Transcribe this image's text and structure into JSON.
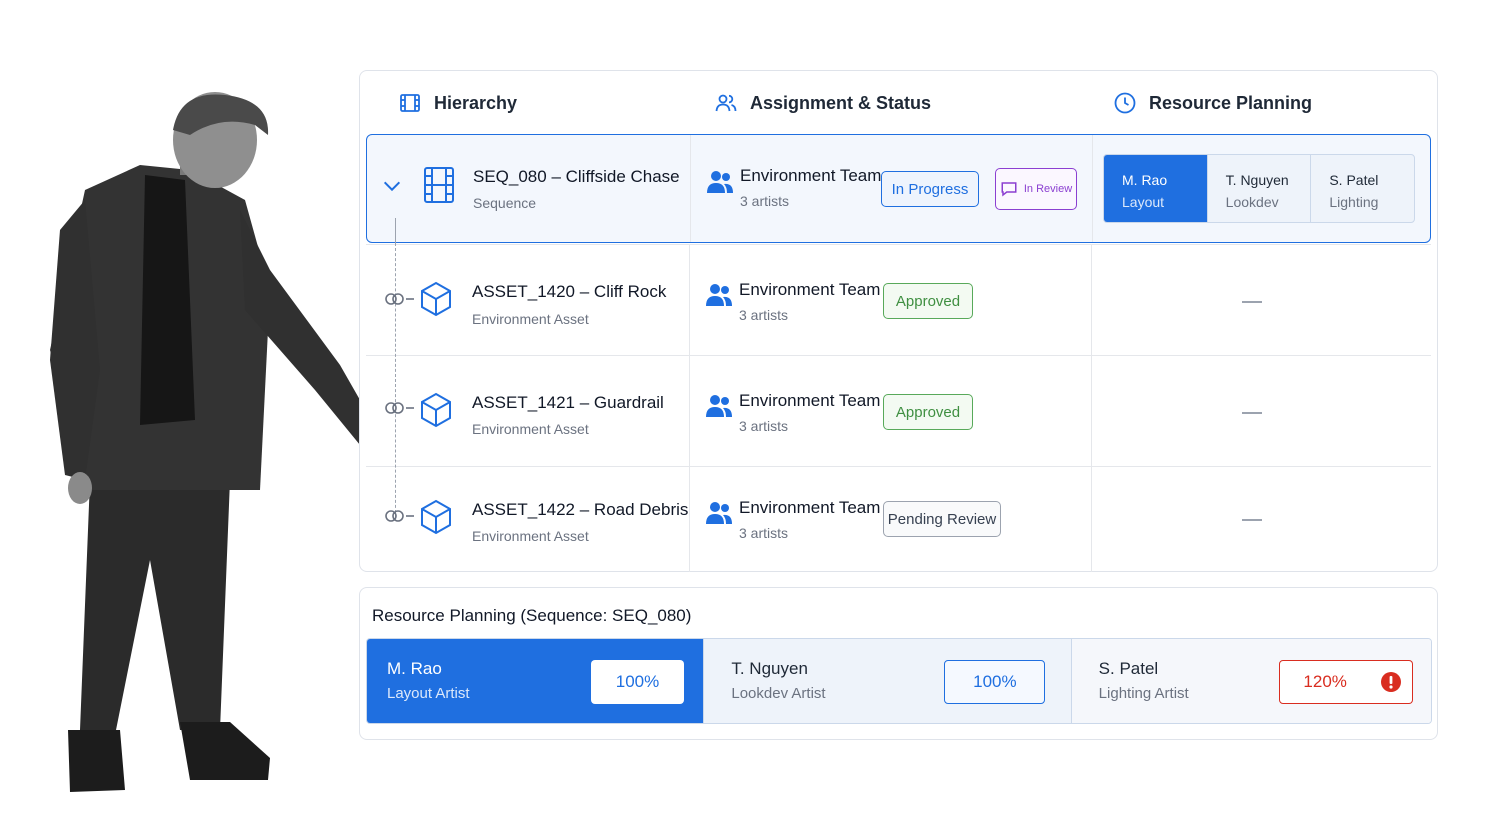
{
  "headers": {
    "hierarchy": "Hierarchy",
    "assignment": "Assignment & Status",
    "resource": "Resource Planning"
  },
  "rows": [
    {
      "title": "SEQ_080 – Cliffside Chase",
      "subtitle": "Sequence",
      "team": "Environment Team",
      "count": "3 artists",
      "status": "In Progress",
      "review": "In Review",
      "planning": [
        {
          "name": "M. Rao",
          "role": "Layout"
        },
        {
          "name": "T. Nguyen",
          "role": "Lookdev"
        },
        {
          "name": "S. Patel",
          "role": "Lighting"
        }
      ]
    },
    {
      "title": "ASSET_1420 – Cliff Rock",
      "subtitle": "Environment Asset",
      "team": "Environment Team",
      "count": "3 artists",
      "status": "Approved"
    },
    {
      "title": "ASSET_1421 – Guardrail",
      "subtitle": "Environment Asset",
      "team": "Environment Team",
      "count": "3 artists",
      "status": "Approved"
    },
    {
      "title": "ASSET_1422 – Road Debris",
      "subtitle": "Environment Asset",
      "team": "Environment Team",
      "count": "3 artists",
      "status": "Pending Review"
    }
  ],
  "resource_panel": {
    "title": "Resource Planning (Sequence: SEQ_080)",
    "artists": [
      {
        "name": "M. Rao",
        "role": "Layout Artist",
        "load": "100%"
      },
      {
        "name": "T. Nguyen",
        "role": "Lookdev Artist",
        "load": "100%"
      },
      {
        "name": "S. Patel",
        "role": "Lighting Artist",
        "load": "120%"
      }
    ]
  },
  "colors": {
    "accent": "#1f6fe0",
    "review": "#8b3fd1",
    "approved": "#58a95a",
    "over_allocated": "#d92d20"
  },
  "icons": {
    "hierarchy": "film-strip-icon",
    "assignment": "users-icon",
    "resource": "clock-icon",
    "sequence": "film-icon",
    "asset": "cube-icon",
    "link": "link-icon",
    "alert": "alert-icon"
  }
}
